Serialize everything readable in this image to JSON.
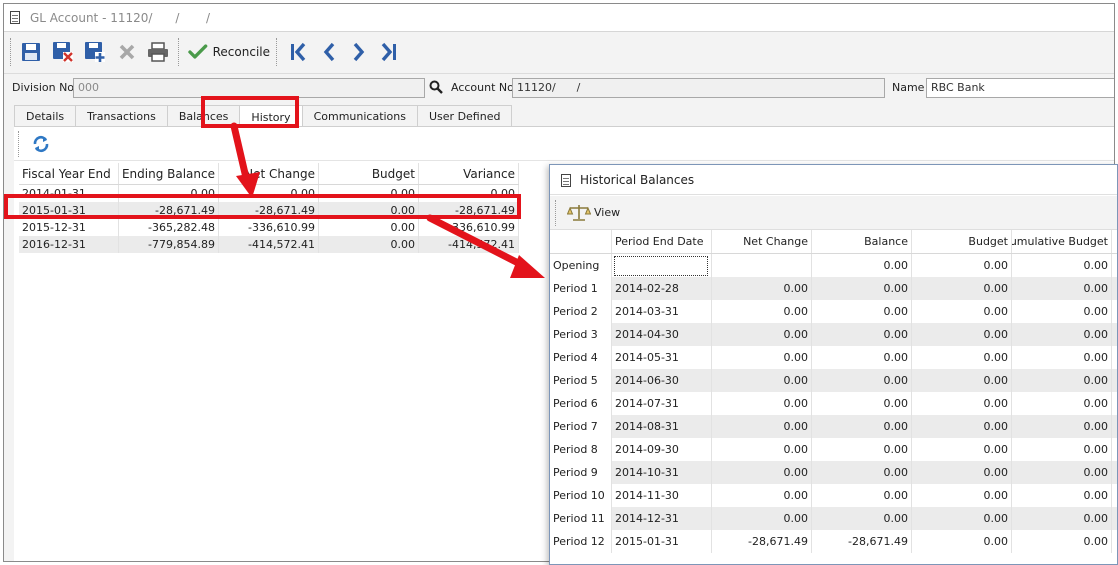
{
  "window": {
    "title": "GL Account - 11120/      /       /"
  },
  "toolbar": {
    "buttons": [
      {
        "name": "save-icon",
        "color": "#2f5fa8"
      },
      {
        "name": "save-close-icon",
        "color": "#2f5fa8"
      },
      {
        "name": "save-new-icon",
        "color": "#2f5fa8"
      },
      {
        "name": "delete-icon",
        "color": "#a8a8a8"
      },
      {
        "name": "print-icon",
        "color": "#555555"
      }
    ],
    "reconcile_label": "Reconcile",
    "nav_icons": [
      "first-record-icon",
      "previous-record-icon",
      "next-record-icon",
      "last-record-icon"
    ]
  },
  "fields": {
    "division_label": "Division No",
    "division_value": "000",
    "account_label": "Account No",
    "account_value": "11120/      /",
    "name_label": "Name",
    "name_value": "RBC Bank"
  },
  "tabs": [
    {
      "label": "Details",
      "active": false
    },
    {
      "label": "Transactions",
      "active": false
    },
    {
      "label": "Balances",
      "active": false
    },
    {
      "label": "History",
      "active": true
    },
    {
      "label": "Communications",
      "active": false
    },
    {
      "label": "User Defined",
      "active": false
    }
  ],
  "history_grid": {
    "columns": [
      "Fiscal Year End",
      "Ending Balance",
      "Net Change",
      "Budget",
      "Variance"
    ],
    "rows": [
      [
        "2014-01-31",
        "0.00",
        "0.00",
        "0.00",
        "0.00"
      ],
      [
        "2015-01-31",
        "-28,671.49",
        "-28,671.49",
        "0.00",
        "-28,671.49"
      ],
      [
        "2015-12-31",
        "-365,282.48",
        "-336,610.99",
        "0.00",
        "-336,610.99"
      ],
      [
        "2016-12-31",
        "-779,854.89",
        "-414,572.41",
        "0.00",
        "-414,572.41"
      ]
    ]
  },
  "popup": {
    "title": "Historical Balances",
    "view_label": "View",
    "columns": [
      "",
      "Period End Date",
      "Net Change",
      "Balance",
      "Budget",
      "Cumulative Budget"
    ],
    "rows": [
      [
        "Opening",
        "",
        "",
        "0.00",
        "0.00",
        "0.00"
      ],
      [
        "Period 1",
        "2014-02-28",
        "0.00",
        "0.00",
        "0.00",
        "0.00"
      ],
      [
        "Period 2",
        "2014-03-31",
        "0.00",
        "0.00",
        "0.00",
        "0.00"
      ],
      [
        "Period 3",
        "2014-04-30",
        "0.00",
        "0.00",
        "0.00",
        "0.00"
      ],
      [
        "Period 4",
        "2014-05-31",
        "0.00",
        "0.00",
        "0.00",
        "0.00"
      ],
      [
        "Period 5",
        "2014-06-30",
        "0.00",
        "0.00",
        "0.00",
        "0.00"
      ],
      [
        "Period 6",
        "2014-07-31",
        "0.00",
        "0.00",
        "0.00",
        "0.00"
      ],
      [
        "Period 7",
        "2014-08-31",
        "0.00",
        "0.00",
        "0.00",
        "0.00"
      ],
      [
        "Period 8",
        "2014-09-30",
        "0.00",
        "0.00",
        "0.00",
        "0.00"
      ],
      [
        "Period 9",
        "2014-10-31",
        "0.00",
        "0.00",
        "0.00",
        "0.00"
      ],
      [
        "Period 10",
        "2014-11-30",
        "0.00",
        "0.00",
        "0.00",
        "0.00"
      ],
      [
        "Period 11",
        "2014-12-31",
        "0.00",
        "0.00",
        "0.00",
        "0.00"
      ],
      [
        "Period 12",
        "2015-01-31",
        "-28,671.49",
        "-28,671.49",
        "0.00",
        "0.00"
      ]
    ]
  },
  "colors": {
    "annotation_red": "#e3131b",
    "accent_blue": "#2f5fa8",
    "check_green": "#4a9a4a"
  }
}
